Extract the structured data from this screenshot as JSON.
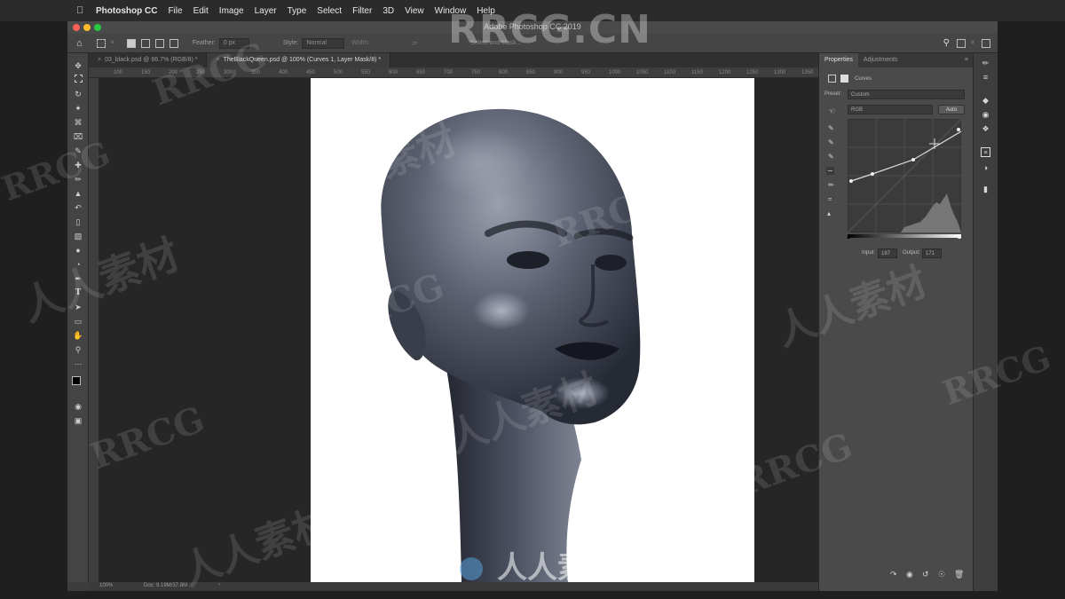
{
  "menubar": {
    "app_name": "Photoshop CC",
    "items": [
      "File",
      "Edit",
      "Image",
      "Layer",
      "Type",
      "Select",
      "Filter",
      "3D",
      "View",
      "Window",
      "Help"
    ]
  },
  "window": {
    "title": "Adobe Photoshop CC 2019"
  },
  "options_bar": {
    "feather_label": "Feather:",
    "feather_value": "0 px",
    "style_label": "Style:",
    "style_value": "Normal",
    "width_label": "Width:",
    "select_mask_label": "Select and Mask..."
  },
  "tabs": [
    {
      "label": "03_black.psd @ 66.7% (RGB/8) *"
    },
    {
      "label": "TheBlackQueen.psd @ 100% (Curves 1, Layer Mask/8) *"
    }
  ],
  "ruler_ticks": [
    "100",
    "150",
    "200",
    "250",
    "300",
    "350",
    "400",
    "450",
    "500",
    "550",
    "600",
    "650",
    "700",
    "750",
    "800",
    "850",
    "900",
    "950",
    "1000",
    "1050",
    "1100",
    "1150",
    "1200",
    "1250",
    "1300",
    "1350"
  ],
  "status_bar": {
    "zoom": "100%",
    "doc_info": "Doc: 9.19M/37.8M"
  },
  "properties_panel": {
    "tab_properties": "Properties",
    "tab_adjustments": "Adjustments",
    "adjustment_name": "Curves",
    "preset_label": "Preset:",
    "preset_value": "Custom",
    "channel_value": "RGB",
    "auto_label": "Auto",
    "input_label": "Input:",
    "input_value": "187",
    "output_label": "Output:",
    "output_value": "171"
  },
  "watermarks": {
    "top_banner": "RRCG.CN",
    "site_name": "RRCG",
    "chinese_text": "人人素材"
  },
  "colors": {
    "menubar_bg": "#2b2b2b",
    "panel_bg": "#4a4a4a",
    "canvas_bg": "#262626",
    "document_bg": "#ffffff",
    "skin_dark": "#2d313e",
    "skin_light": "#8b91a0"
  },
  "icons": {
    "toolbar": [
      "move-icon",
      "marquee-icon",
      "lasso-icon",
      "magic-wand-icon",
      "crop-icon",
      "frame-icon",
      "eyedropper-icon",
      "healing-brush-icon",
      "brush-icon",
      "clone-stamp-icon",
      "history-brush-icon",
      "eraser-icon",
      "gradient-icon",
      "blur-icon",
      "dodge-icon",
      "pen-icon",
      "type-icon",
      "path-selection-icon",
      "rectangle-icon",
      "hand-icon",
      "zoom-icon",
      "more-icon",
      "colors-icon",
      "quick-mask-icon",
      "screen-mode-icon"
    ],
    "right_column": [
      "brush-settings-icon",
      "adjust-icon",
      "layers-icon",
      "channels-icon",
      "paths-icon",
      "properties-icon",
      "adjustments-icon",
      "libraries-icon"
    ]
  }
}
